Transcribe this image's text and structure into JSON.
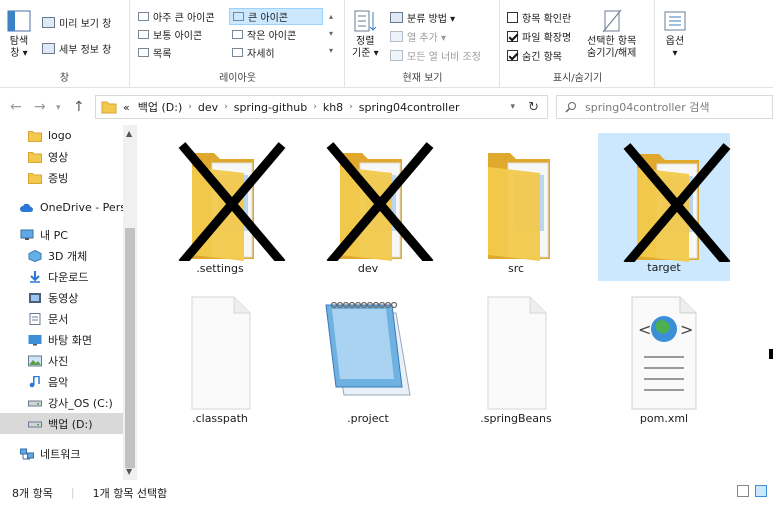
{
  "ribbon": {
    "pane": {
      "nav_pane_label": "탐색\n창 ▾",
      "preview_label": "미리 보기 창",
      "details_label": "세부 정보 창",
      "group_label": "창"
    },
    "layout": {
      "items": [
        "아주 큰 아이콘",
        "큰 아이콘",
        "작은 아이콘",
        "보통 아이콘",
        "목록",
        "자세히"
      ],
      "selected": "큰 아이콘",
      "group_label": "레이아웃"
    },
    "current_view": {
      "sort_label": "정렬\n기준 ▾",
      "group_by_label": "분류 방법 ▾",
      "add_column_label": "열 추가 ▾",
      "fit_columns_label": "모든 열 너비 조정",
      "group_label": "현재 보기"
    },
    "show_hide": {
      "item_checkboxes_label": "항목 확인란",
      "item_checkboxes_checked": false,
      "file_ext_label": "파일 확장명",
      "file_ext_checked": true,
      "hidden_items_label": "숨긴 항목",
      "hidden_items_checked": true,
      "hide_selected_label": "선택한 항목\n숨기기/해제",
      "group_label": "표시/숨기기"
    },
    "options": {
      "label": "옵션\n▾"
    }
  },
  "address": {
    "prefix": "«",
    "crumbs": [
      "백업 (D:)",
      "dev",
      "spring-github",
      "kh8",
      "spring04controller"
    ],
    "search_placeholder": "spring04controller 검색"
  },
  "nav": {
    "items": [
      {
        "label": "logo",
        "icon": "folder-icon"
      },
      {
        "label": "영상",
        "icon": "folder-icon"
      },
      {
        "label": "증빙",
        "icon": "folder-icon"
      },
      {
        "label": "OneDrive - Person",
        "icon": "cloud-icon"
      },
      {
        "label": "내 PC",
        "icon": "pc-icon"
      },
      {
        "label": "3D 개체",
        "icon": "cube-icon"
      },
      {
        "label": "다운로드",
        "icon": "download-icon"
      },
      {
        "label": "동영상",
        "icon": "video-icon"
      },
      {
        "label": "문서",
        "icon": "document-icon"
      },
      {
        "label": "바탕 화면",
        "icon": "desktop-icon"
      },
      {
        "label": "사진",
        "icon": "picture-icon"
      },
      {
        "label": "음악",
        "icon": "music-icon"
      },
      {
        "label": "강사_OS (C:)",
        "icon": "drive-icon"
      },
      {
        "label": "백업 (D:)",
        "icon": "drive-icon"
      },
      {
        "label": "네트워크",
        "icon": "network-icon"
      }
    ],
    "selected_index": 13
  },
  "files": [
    {
      "name": ".settings",
      "kind": "folder",
      "crossed": true,
      "selected": false
    },
    {
      "name": "dev",
      "kind": "folder",
      "crossed": true,
      "selected": false
    },
    {
      "name": "src",
      "kind": "folder",
      "crossed": false,
      "selected": false
    },
    {
      "name": "target",
      "kind": "folder",
      "crossed": true,
      "selected": true
    },
    {
      "name": ".classpath",
      "kind": "file",
      "crossed": false,
      "selected": false
    },
    {
      "name": ".project",
      "kind": "notepad",
      "crossed": false,
      "selected": false
    },
    {
      "name": ".springBeans",
      "kind": "file",
      "crossed": false,
      "selected": false
    },
    {
      "name": "pom.xml",
      "kind": "xml",
      "crossed": false,
      "selected": false
    }
  ],
  "status": {
    "count": "8개 항목",
    "selection": "1개 항목 선택함"
  },
  "colors": {
    "folder": "#f2c94c",
    "folder_dark": "#e0a92e",
    "selection": "#cce8ff",
    "cross": "#000000"
  }
}
